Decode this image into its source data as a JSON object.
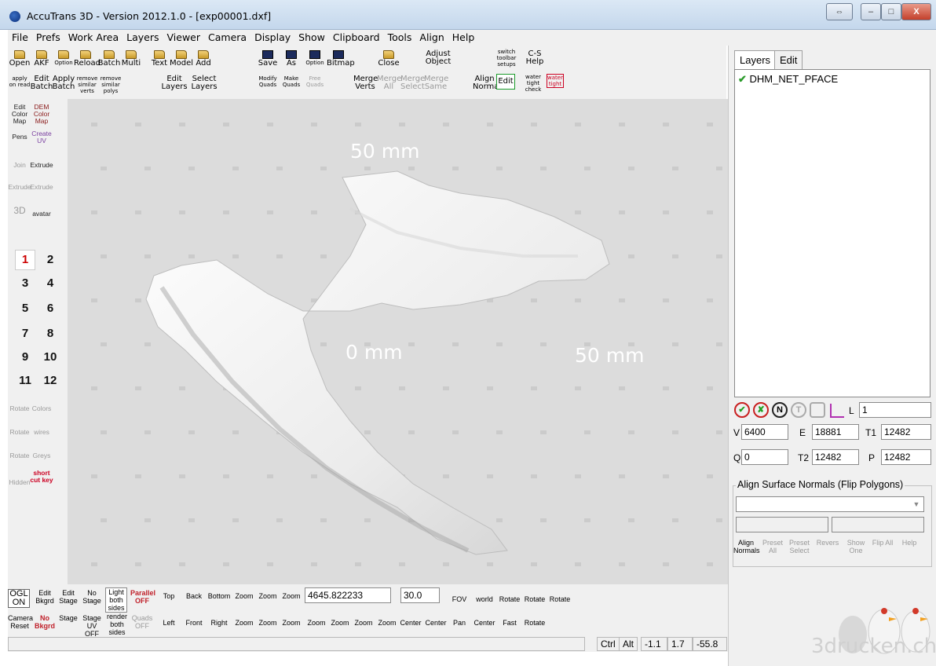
{
  "window": {
    "title": "AccuTrans 3D - Version 2012.1.0 - [exp00001.dxf]",
    "controls": {
      "restore": "⇔",
      "minimize": "–",
      "maximize": "□",
      "close": "X"
    }
  },
  "menu": [
    "File",
    "Prefs",
    "Work Area",
    "Layers",
    "Viewer",
    "Camera",
    "Display",
    "Show",
    "Clipboard",
    "Tools",
    "Align",
    "Help"
  ],
  "toolbar": {
    "open": "Open",
    "akf": "AKF",
    "option": "Option",
    "reload": "Reload",
    "batch": "Batch",
    "multi": "Multi",
    "text": "Text",
    "model": "Model",
    "add": "Add",
    "apply_on_read": "apply on read",
    "edit_batch": "Edit Batch",
    "apply_batch": "Apply Batch",
    "remove_similar_verts": "remove similar verts",
    "remove_similar_polys": "remove similar polys",
    "edit_layers": "Edit Layers",
    "select_layers": "Select Layers",
    "save": "Save",
    "save_as": "As",
    "save_option": "Option",
    "bitmap": "Bitmap",
    "modify_quads": "Modify Quads",
    "make_quads": "Make Quads",
    "free_quads": "Free Quads",
    "close": "Close",
    "merge_verts": "Merge Verts",
    "merge_all": "Merge All",
    "merge_select": "Merge Select",
    "merge_same": "Merge Same",
    "adjust_object": "Adjust Object",
    "switch_toolbar_setups": "switch toolbar setups",
    "cs_help": "C-S Help",
    "align_normals": "Align Normals",
    "edit": "Edit",
    "water_tight_check": "water tight check",
    "water_tight": "water tight"
  },
  "left_tools": {
    "edit_color_map": "Edit Color Map",
    "dem_color_map": "DEM Color Map",
    "pens": "Pens",
    "create_uv": "Create UV",
    "join": "Join",
    "extrude": "Extrude",
    "k_extrude": "Extrude",
    "m_extrude": "Extrude",
    "to_3d": "3D",
    "avatar": "avatar",
    "layers": [
      "1",
      "2",
      "3",
      "4",
      "5",
      "6",
      "7",
      "8",
      "9",
      "10",
      "11",
      "12"
    ],
    "bbox_rotate": "Rotate",
    "colors": "Colors",
    "verts_rotate": "Rotate",
    "wires": "wires",
    "wires_rotate": "Rotate",
    "greys": "Greys",
    "hidden": "Hidden",
    "short_cut_key": "short cut key"
  },
  "viewport": {
    "label_top": "50 mm",
    "label_origin": "0 mm",
    "label_right": "50 mm"
  },
  "right_panel": {
    "tabs": [
      "Layers",
      "Edit"
    ],
    "layers": [
      {
        "name": "DHM_NET_PFACE",
        "visible": true
      }
    ],
    "buttons": {
      "n": "N",
      "t": "T"
    },
    "l_label": "L",
    "l_value": "1",
    "v_label": "V",
    "v_value": "6400",
    "e_label": "E",
    "e_value": "18881",
    "t1_label": "T1",
    "t1_value": "12482",
    "q_label": "Q",
    "q_value": "0",
    "t2_label": "T2",
    "t2_value": "12482",
    "p_label": "P",
    "p_value": "12482",
    "align_group_title": "Align Surface Normals (Flip Polygons)",
    "align_buttons": [
      "Align Normals",
      "Preset All",
      "Preset Select",
      "Revers",
      "Show One",
      "Flip All",
      "Help"
    ]
  },
  "bottom_bar": {
    "ogl_on": "OGL ON",
    "edit_bkgrd": "Edit Bkgrd",
    "edit_stage": "Edit Stage",
    "no_stage": "No Stage",
    "light_both_sides": "Light both sides",
    "parallel_off": "Parallel OFF",
    "top": "Top",
    "back": "Back",
    "bottom": "Bottom",
    "zoom1": "Zoom",
    "zoom2": "Zoom",
    "zoom3": "Zoom",
    "zoom_value": "4645.822233",
    "fov_value": "30.0",
    "fov": "FOV",
    "cc_world": "world",
    "rotate_x": "Rotate",
    "rotate_y": "Rotate",
    "rotate_z": "Rotate",
    "camera_reset": "Camera Reset",
    "no_bkgrd": "No Bkgrd",
    "stage": "Stage",
    "stage_uv_off": "Stage UV OFF",
    "render_both_sides": "render both sides",
    "quads_off": "Quads OFF",
    "left": "Left",
    "front": "Front",
    "right": "Right",
    "zoom4": "Zoom",
    "zoom5": "Zoom",
    "zoom6": "Zoom",
    "zoom_a": "Zoom",
    "zoom_in": "Zoom",
    "zoom_out": "Zoom",
    "zoom_zoom": "Zoom",
    "center_x": "Center",
    "center_z": "Center",
    "pan": "Pan",
    "center_pivot": "Center",
    "fast": "Fast",
    "rotate": "Rotate"
  },
  "status": {
    "ctrl": "Ctrl",
    "alt": "Alt",
    "x": "-1.1",
    "y": "1.7",
    "z": "-55.8"
  },
  "watermark": "3drucken.ch"
}
